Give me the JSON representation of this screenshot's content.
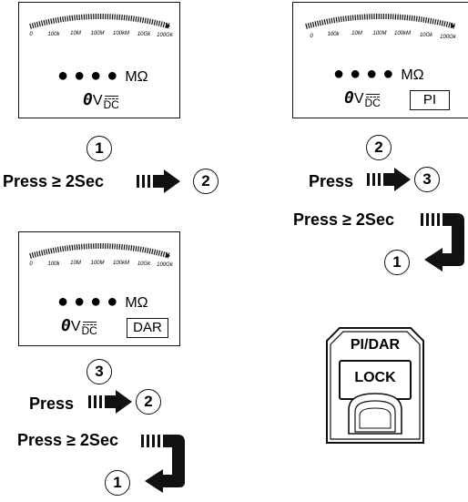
{
  "scale_labels": [
    "0",
    "100k",
    "10M",
    "100M",
    "100kM",
    "10Gk",
    "100Gk"
  ],
  "display": {
    "unit": "MΩ",
    "voltage_digit": "0",
    "voltage_unit": "V",
    "dc_label": "DC"
  },
  "panels": [
    {
      "mode_box": "",
      "step_number": "1",
      "press_line": "Press ≥ 2Sec",
      "press_target": "2"
    },
    {
      "mode_box": "PI",
      "step_number": "2",
      "press_line": "Press",
      "press_target": "3",
      "hold_line": "Press ≥ 2Sec",
      "hold_target": "1"
    },
    {
      "mode_box": "DAR",
      "step_number": "3",
      "press_line": "Press",
      "press_target": "2",
      "hold_line": "Press ≥ 2Sec",
      "hold_target": "1"
    }
  ],
  "lock_button": {
    "top_label": "PI/DAR",
    "bottom_label": "LOCK"
  }
}
